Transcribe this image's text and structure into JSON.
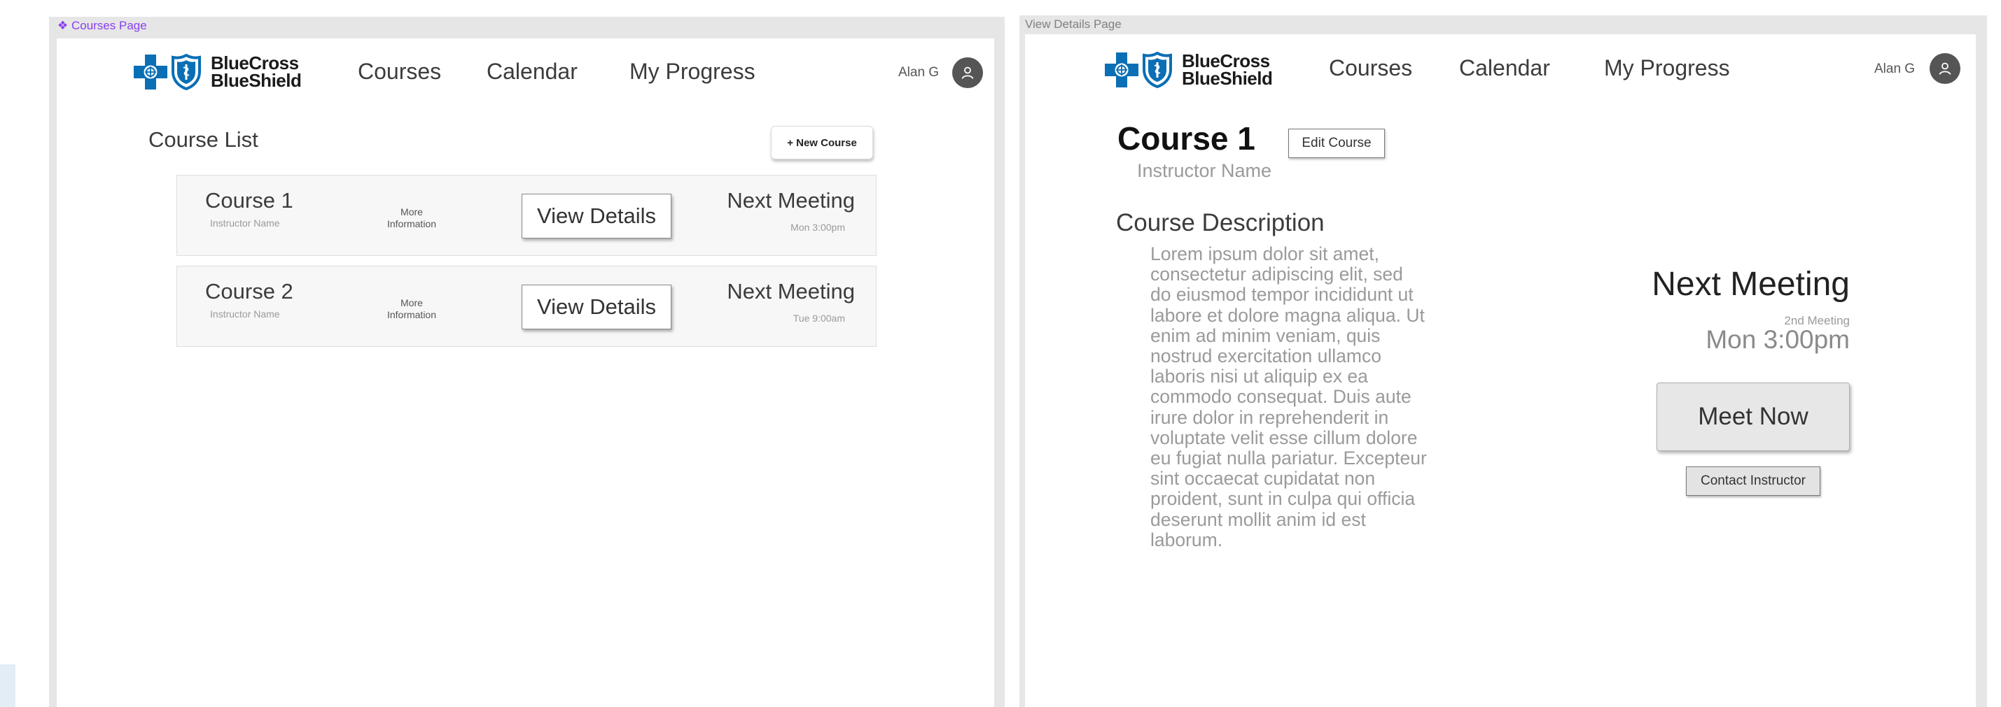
{
  "brand": {
    "name_line1": "BlueCross",
    "name_line2": "BlueShield",
    "color": "#0a6fb5"
  },
  "nav": {
    "courses": "Courses",
    "calendar": "Calendar",
    "my_progress": "My Progress",
    "user_name": "Alan G"
  },
  "courses_page": {
    "frame_label": "❖ Courses Page",
    "frame_label_color": "#8a3ff0",
    "title": "Course List",
    "new_course_label": "+ New Course",
    "courses": [
      {
        "title": "Course 1",
        "instructor": "Instructor Name",
        "more_line1": "More",
        "more_line2": "Information",
        "view_label": "View Details",
        "next_label": "Next Meeting",
        "next_time": "Mon 3:00pm"
      },
      {
        "title": "Course 2",
        "instructor": "Instructor Name",
        "more_line1": "More",
        "more_line2": "Information",
        "view_label": "View Details",
        "next_label": "Next Meeting",
        "next_time": "Tue 9:00am"
      }
    ]
  },
  "details_page": {
    "frame_label": "View Details Page",
    "title": "Course 1",
    "edit_label": "Edit Course",
    "instructor": "Instructor Name",
    "description_heading": "Course Description",
    "description_lines": [
      "Lorem ipsum dolor sit amet,",
      "consectetur adipiscing elit, sed",
      "do eiusmod tempor incididunt ut",
      "labore et dolore magna aliqua. Ut",
      "enim ad minim veniam, quis",
      "nostrud exercitation ullamco",
      "laboris nisi ut aliquip ex ea",
      "commodo consequat. Duis aute",
      "irure dolor in reprehenderit in",
      "voluptate velit esse cillum dolore",
      "eu fugiat nulla pariatur. Excepteur",
      "sint occaecat cupidatat non",
      "proident, sunt in culpa qui officia",
      "deserunt mollit anim id est",
      "laborum."
    ],
    "next_meeting_heading": "Next Meeting",
    "meeting_number": "2nd Meeting",
    "meeting_time": "Mon 3:00pm",
    "meet_now_label": "Meet Now",
    "contact_label": "Contact Instructor"
  }
}
